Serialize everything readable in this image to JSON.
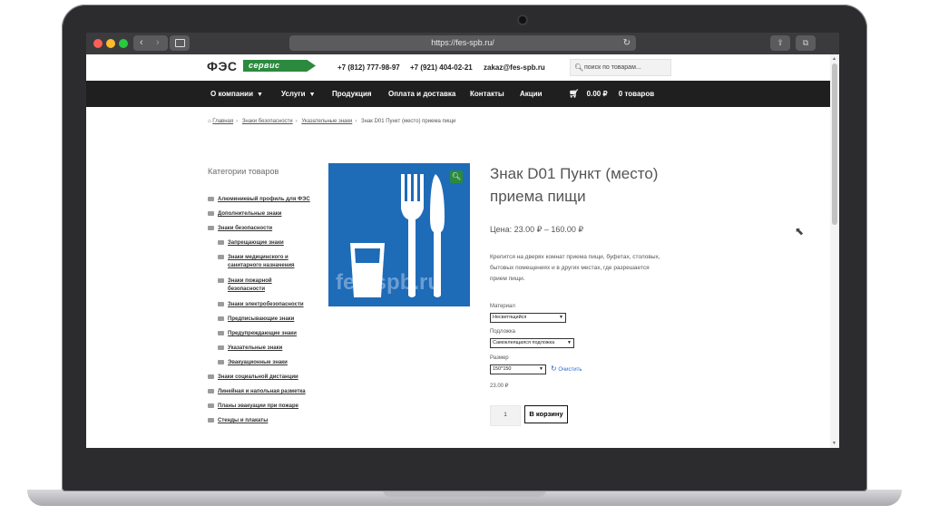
{
  "browser": {
    "url": "https://fes-spb.ru/",
    "back_glyph": "‹",
    "forward_glyph": "›",
    "reload_glyph": "↻",
    "share_glyph": "⇪",
    "tabs_glyph": "⧉"
  },
  "header": {
    "logo_main": "ФЭС",
    "logo_sub": "сервис",
    "phone1": "+7 (812) 777-98-97",
    "phone2": "+7 (921) 404-02-21",
    "email": "zakaz@fes-spb.ru",
    "search_placeholder": "поиск по товарам...",
    "brand_color": "#2b8a3e"
  },
  "nav": {
    "items": [
      "О компании",
      "Услуги",
      "Продукция",
      "Оплата и доставка",
      "Контакты",
      "Акции"
    ],
    "cart_total": "0.00 ₽",
    "cart_count": "0 товаров"
  },
  "breadcrumb": [
    "Главная",
    "Знаки безопасности",
    "Указательные знаки",
    "Знак D01 Пункт (место) приема пищи"
  ],
  "sidebar": {
    "title": "Категории товаров",
    "items": [
      "Алюминиевый профиль для ФЭС",
      "Дополнительные знаки",
      "Знаки безопасности",
      "Запрещающие знаки",
      "Знаки медицинского и",
      "санитарного назначения",
      "Знаки пожарной",
      "безопасности",
      "Знаки электробезопасности",
      "Предписывающие знаки",
      "Предупреждающие знаки",
      "Указательные знаки",
      "Эвакуационные знаки",
      "Знаки социальной дистанции",
      "Линейная и напольная разметка",
      "Планы эвакуации при пожаре",
      "Стенды и плакаты"
    ]
  },
  "product": {
    "image_watermark": "fes-spb.ru",
    "sign_color": "#1e6bb8",
    "title": "Знак D01 Пункт (место) приема пищи",
    "price": "Цена: 23.00 ₽ – 160.00 ₽",
    "description": "Крепится на дверях комнат приема пищи, буфетах, столовых, бытовых помещениях и в других местах, где разрешается прием пищи.",
    "material_label": "Материал",
    "material_value": "Несветящийся",
    "backing_label": "Подложка",
    "backing_value": "Самоклеящаяся подложка",
    "size_label": "Размер",
    "size_value": "150*150",
    "clear_label": "Очистить",
    "variation_price": "23.00 ₽",
    "quantity": "1",
    "add_to_cart": "В корзину"
  }
}
